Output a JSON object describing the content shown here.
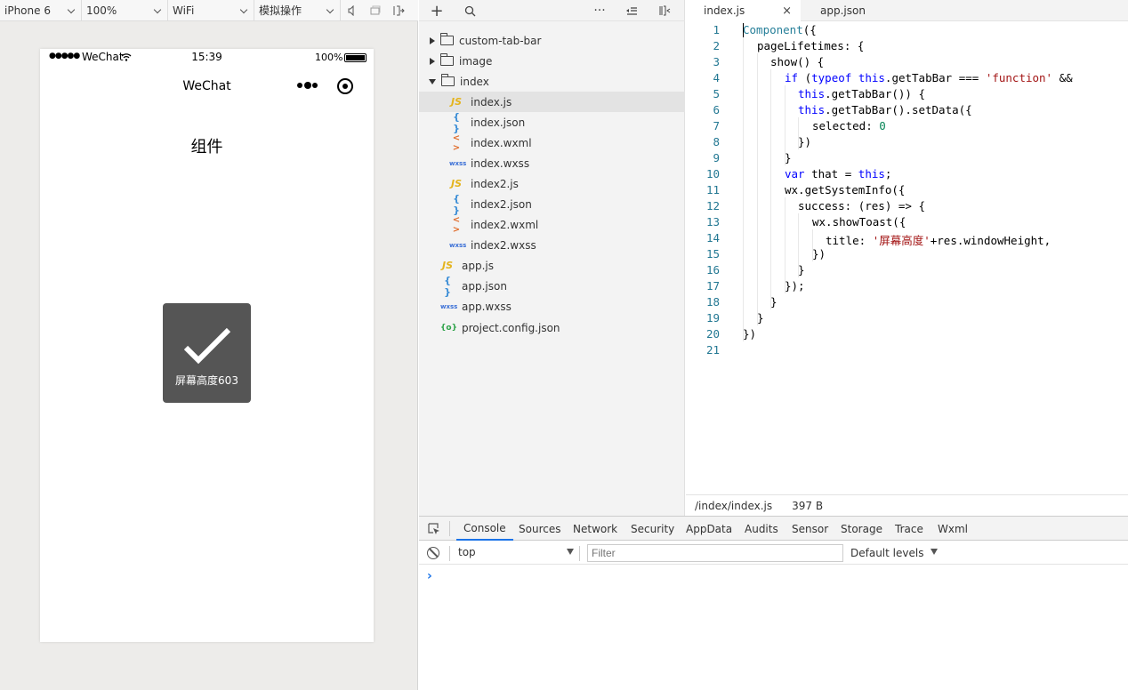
{
  "simulator": {
    "toolbar": {
      "device": "iPhone 6",
      "zoom": "100%",
      "network": "WiFi",
      "operation": "模拟操作"
    },
    "statusbar": {
      "signal": "●●●●●",
      "carrier": "WeChat",
      "time": "15:39",
      "battery": "100%"
    },
    "navbar": {
      "title": "WeChat"
    },
    "page": {
      "heading": "组件"
    },
    "toast": {
      "text": "屏幕高度603",
      "icon": "checkmark-icon"
    }
  },
  "explorer": {
    "items": [
      {
        "name": "custom-tab-bar",
        "type": "folder",
        "expanded": false
      },
      {
        "name": "image",
        "type": "folder",
        "expanded": false
      },
      {
        "name": "index",
        "type": "folder",
        "expanded": true
      },
      {
        "name": "index.js",
        "type": "js",
        "selected": true
      },
      {
        "name": "index.json",
        "type": "json"
      },
      {
        "name": "index.wxml",
        "type": "wxml"
      },
      {
        "name": "index.wxss",
        "type": "wxss"
      },
      {
        "name": "index2.js",
        "type": "js"
      },
      {
        "name": "index2.json",
        "type": "json"
      },
      {
        "name": "index2.wxml",
        "type": "wxml"
      },
      {
        "name": "index2.wxss",
        "type": "wxss"
      },
      {
        "name": "app.js",
        "type": "js"
      },
      {
        "name": "app.json",
        "type": "json"
      },
      {
        "name": "app.wxss",
        "type": "wxss"
      },
      {
        "name": "project.config.json",
        "type": "config"
      }
    ],
    "icon_labels": {
      "js": "JS",
      "json": "{ }",
      "wxml": "< >",
      "wxss": "wxss",
      "config": "{o}"
    }
  },
  "editor": {
    "tabs": [
      {
        "label": "index.js",
        "active": true
      },
      {
        "label": "app.json",
        "active": false
      }
    ],
    "close_glyph": "×",
    "line_numbers": [
      "1",
      "2",
      "3",
      "4",
      "5",
      "6",
      "7",
      "8",
      "9",
      "10",
      "11",
      "12",
      "13",
      "14",
      "15",
      "16",
      "17",
      "18",
      "19",
      "20",
      "21"
    ],
    "code": {
      "l1": [
        "Component",
        "({"
      ],
      "l2": "pageLifetimes: {",
      "l3": "show() {",
      "l4": [
        "if",
        " (",
        "typeof",
        " ",
        "this",
        ".getTabBar === ",
        "'function'",
        " &&"
      ],
      "l5": [
        "this",
        ".getTabBar()) {"
      ],
      "l6": [
        "this",
        ".getTabBar().setData({"
      ],
      "l7": [
        "selected: ",
        "0"
      ],
      "l8": "})",
      "l9": "}",
      "l10": [
        "var",
        " that = ",
        "this",
        ";"
      ],
      "l11": "wx.getSystemInfo({",
      "l12": "success: (res) => {",
      "l13": "wx.showToast({",
      "l14": [
        "title: ",
        "'屏幕高度'",
        "+res.windowHeight,"
      ],
      "l15": "})",
      "l16": "}",
      "l17": "});",
      "l18": "}",
      "l19": "}",
      "l20": "})",
      "l21": ""
    },
    "status": {
      "path": "/index/index.js",
      "size": "397 B"
    }
  },
  "devtools": {
    "tabs": [
      "Console",
      "Sources",
      "Network",
      "Security",
      "AppData",
      "Audits",
      "Sensor",
      "Storage",
      "Trace",
      "Wxml"
    ],
    "active_tab": "Console",
    "context": "top",
    "filter_placeholder": "Filter",
    "levels": "Default levels",
    "prompt": "›"
  },
  "colors": {
    "accent": "#1a73e8",
    "toast_bg": "#4c4c4c",
    "keyword": "#0000ff",
    "string": "#a31515",
    "number": "#098658"
  }
}
